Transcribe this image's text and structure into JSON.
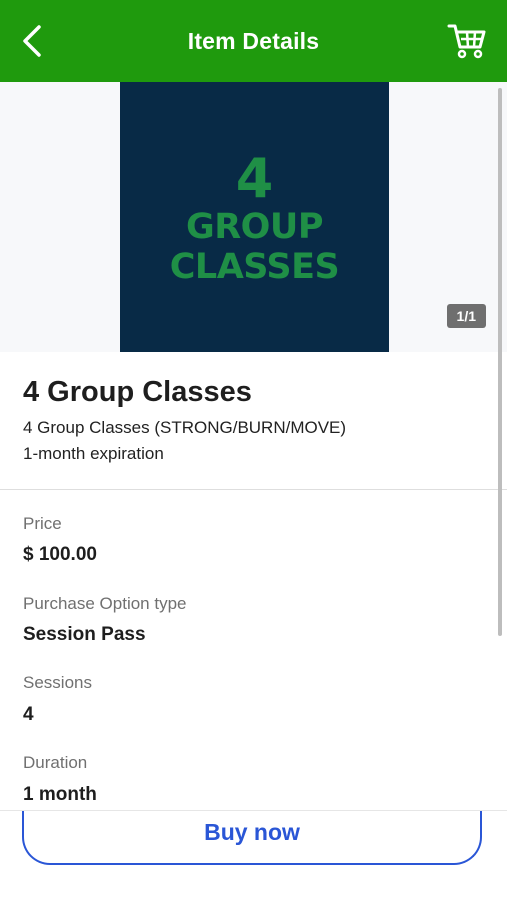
{
  "header": {
    "title": "Item Details",
    "back_icon": "chevron-left-icon",
    "cart_icon": "cart-icon",
    "background_color": "#1f9a0d"
  },
  "gallery": {
    "image_text_number": "4",
    "image_text_line1": "GROUP",
    "image_text_line2": "CLASSES",
    "counter": "1/1",
    "image_bg_color": "#082a46",
    "image_text_color": "#1f8f46"
  },
  "item": {
    "title": "4 Group Classes",
    "subtitle": "4 Group Classes (STRONG/BURN/MOVE)",
    "description": "1-month expiration"
  },
  "details": [
    {
      "label": "Price",
      "value": "$ 100.00"
    },
    {
      "label": "Purchase Option type",
      "value": "Session Pass"
    },
    {
      "label": "Sessions",
      "value": "4"
    },
    {
      "label": "Duration",
      "value": "1 month"
    }
  ],
  "actions": {
    "buy_label": "Buy now",
    "accent_color": "#2a56d6"
  }
}
